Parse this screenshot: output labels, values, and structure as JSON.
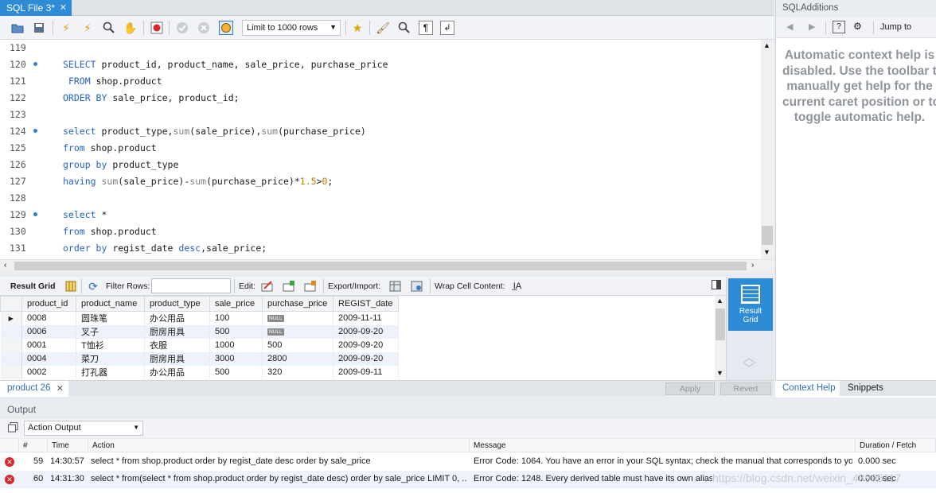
{
  "tab": {
    "title": "SQL File 3*",
    "close": "✕"
  },
  "toolbar": {
    "limit_select": "Limit to 1000 rows"
  },
  "editor": {
    "lines": [
      {
        "n": "119",
        "dot": false,
        "html": ""
      },
      {
        "n": "120",
        "dot": true,
        "html": "<span class='kw'>SELECT</span> product_id, product_name, sale_price, purchase_price"
      },
      {
        "n": "121",
        "dot": false,
        "html": " <span class='kw'>FROM</span> shop.product"
      },
      {
        "n": "122",
        "dot": false,
        "html": "<span class='kw'>ORDER BY</span> sale_price, product_id;"
      },
      {
        "n": "123",
        "dot": false,
        "html": ""
      },
      {
        "n": "124",
        "dot": true,
        "html": "<span class='kw'>select</span> product_type,<span class='fn'>sum</span>(sale_price),<span class='fn'>sum</span>(purchase_price)"
      },
      {
        "n": "125",
        "dot": false,
        "html": "<span class='kw'>from</span> shop.product"
      },
      {
        "n": "126",
        "dot": false,
        "html": "<span class='kw'>group by</span> product_type"
      },
      {
        "n": "127",
        "dot": false,
        "html": "<span class='kw'>having</span> <span class='fn'>sum</span>(sale_price)-<span class='fn'>sum</span>(purchase_price)*<span class='num'>1.5</span>&gt;<span class='num'>0</span>;"
      },
      {
        "n": "128",
        "dot": false,
        "html": ""
      },
      {
        "n": "129",
        "dot": true,
        "html": "<span class='kw'>select</span> *"
      },
      {
        "n": "130",
        "dot": false,
        "html": "<span class='kw'>from</span> shop.product"
      },
      {
        "n": "131",
        "dot": false,
        "html": "<span class='kw'>order by</span> regist_date <span class='kw'>desc</span>,sale_price;"
      }
    ]
  },
  "result_toolbar": {
    "result_grid": "Result Grid",
    "filter_rows": "Filter Rows:",
    "edit": "Edit:",
    "export_import": "Export/Import:",
    "wrap_cell": "Wrap Cell Content:"
  },
  "grid": {
    "columns": [
      "product_id",
      "product_name",
      "product_type",
      "sale_price",
      "purchase_price",
      "REGIST_date"
    ],
    "rows": [
      [
        "0008",
        "圆珠笔",
        "办公用品",
        "100",
        "NULL",
        "2009-11-11"
      ],
      [
        "0006",
        "叉子",
        "厨房用具",
        "500",
        "NULL",
        "2009-09-20"
      ],
      [
        "0001",
        "T恤衫",
        "衣服",
        "1000",
        "500",
        "2009-09-20"
      ],
      [
        "0004",
        "菜刀",
        "厨房用具",
        "3000",
        "2800",
        "2009-09-20"
      ],
      [
        "0002",
        "打孔器",
        "办公用品",
        "500",
        "320",
        "2009-09-11"
      ]
    ]
  },
  "side_panel_button": {
    "line1": "Result",
    "line2": "Grid"
  },
  "result_tab": {
    "label": "product 26",
    "close": "✕"
  },
  "buttons": {
    "apply": "Apply",
    "revert": "Revert"
  },
  "output": {
    "header": "Output",
    "select": "Action Output",
    "columns": [
      "#",
      "Time",
      "Action",
      "Message",
      "Duration / Fetch"
    ],
    "rows": [
      {
        "num": "59",
        "time": "14:30:57",
        "action": "select * from shop.product  order by regist_date desc  order by sale_price",
        "message": "Error Code: 1064. You have an error in your SQL syntax; check the manual that corresponds to yo...",
        "duration": "0.000 sec"
      },
      {
        "num": "60",
        "time": "14:31:30",
        "action": "select * from(select * from shop.product  order by regist_date desc)  order by sale_price LIMIT 0, ...",
        "message": "Error Code: 1248. Every derived table must have its own alias",
        "duration": "0.000 sec"
      }
    ],
    "watermark": "https://blog.csdn.net/weixin_43985117"
  },
  "right_panel": {
    "title": "SQLAdditions",
    "jump_to": "Jump to",
    "help_lines": [
      "Automatic context help is",
      "disabled. Use the toolbar to",
      "manually get help for the",
      "current caret position or to",
      "toggle automatic help."
    ],
    "tabs": [
      "Context Help",
      "Snippets"
    ]
  },
  "colors": {
    "accent": "#2e8bd6",
    "keyword": "#2262c6",
    "error": "#d7262c"
  }
}
